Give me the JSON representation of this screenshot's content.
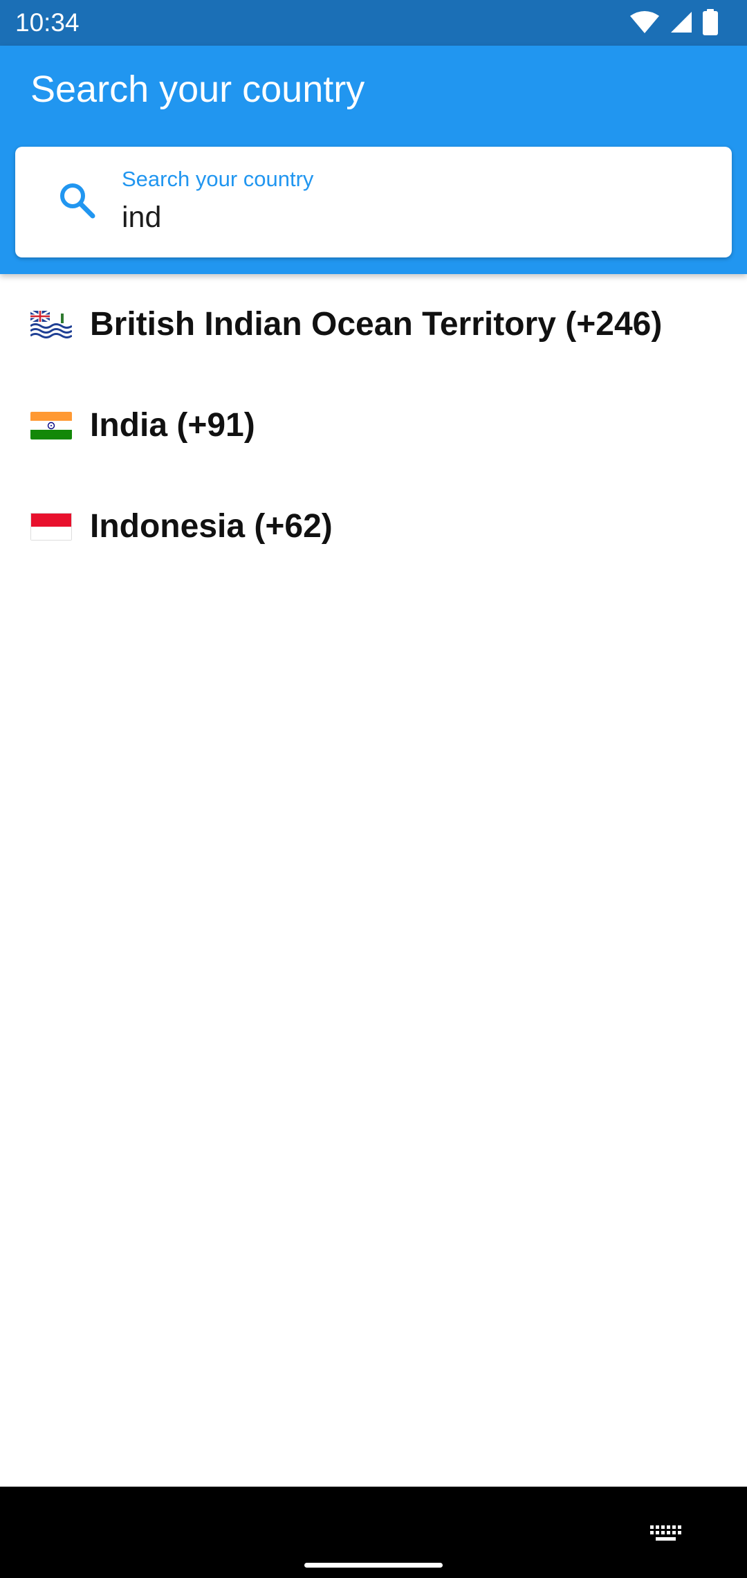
{
  "status_bar": {
    "time": "10:34",
    "icons": [
      "wifi-icon",
      "signal-icon",
      "battery-icon"
    ]
  },
  "app_bar": {
    "title": "Search your country",
    "background_color": "#2196f0"
  },
  "search": {
    "label": "Search your country",
    "value": "ind",
    "icon": "search-icon",
    "accent_color": "#2196f0"
  },
  "countries": [
    {
      "flag": "british-indian-ocean-territory-flag-icon",
      "name": "British Indian Ocean Territory (+246)"
    },
    {
      "flag": "india-flag-icon",
      "name": "India (+91)"
    },
    {
      "flag": "indonesia-flag-icon",
      "name": "Indonesia (+62)"
    }
  ],
  "nav_bar": {
    "icons": [
      "keyboard-icon",
      "home-handle"
    ]
  }
}
